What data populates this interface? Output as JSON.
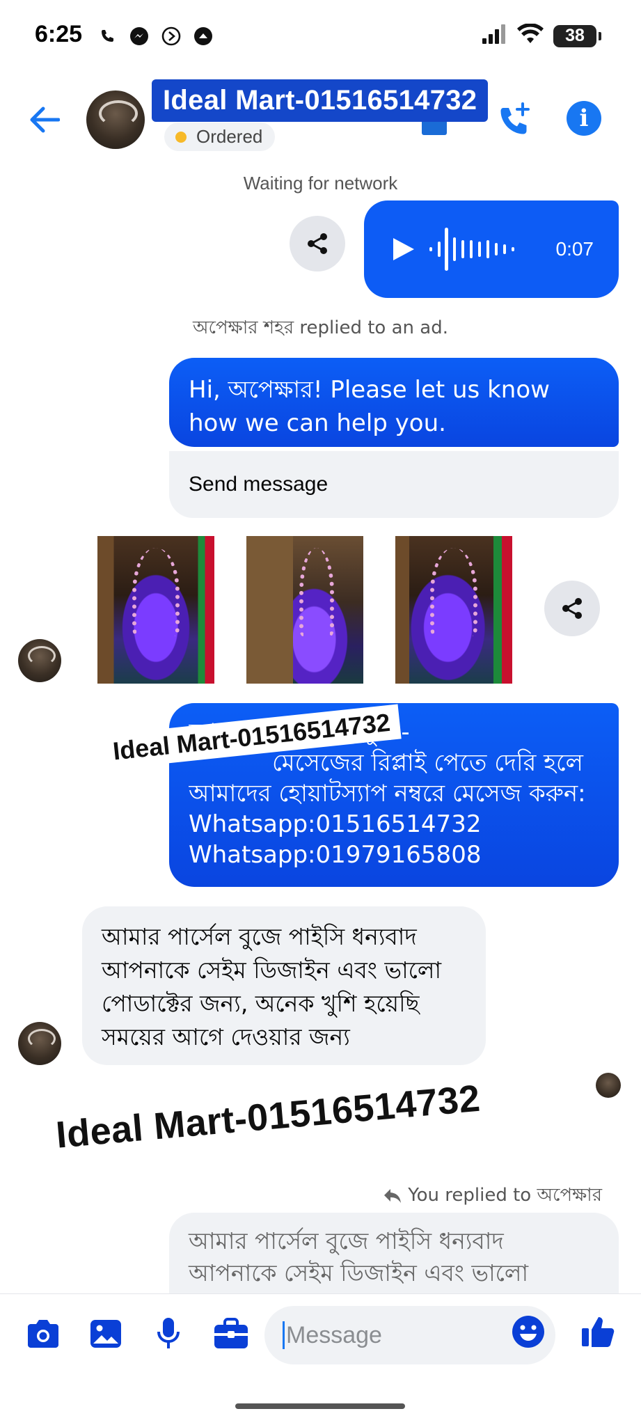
{
  "status_bar": {
    "time": "6:25",
    "battery": "38",
    "left_icons": [
      "phone-icon",
      "messenger-icon",
      "arrow-circle-icon",
      "record-icon"
    ],
    "right_icons": [
      "signal-icon",
      "wifi-icon",
      "battery-icon"
    ]
  },
  "header": {
    "title": "Ideal Mart-01516514732",
    "status_label": "Ordered",
    "status_color": "#f7b928",
    "accent_color": "#0866ff"
  },
  "network_status": "Waiting for network",
  "voice_message": {
    "duration": "0:07"
  },
  "system_message": "অপেক্ষার শহর replied to an ad.",
  "greeting": {
    "text": "Hi, অপেক্ষার! Please let us know how we can help you.",
    "action_label": "Send message"
  },
  "photos": [
    "photo-1",
    "photo-2",
    "photo-3"
  ],
  "bangla_message": {
    "lines": [
      "আসসালামু আলাইকুম -",
      "মেসেজের রিপ্লাই পেতে দেরি হলে",
      "আমাদের হোয়াটস্যাপ নম্বরে মেসেজ করুন:",
      "Whatsapp:01516514732",
      "Whatsapp:01979165808"
    ]
  },
  "watermarks": {
    "small": "Ideal Mart-01516514732",
    "large": "Ideal Mart-01516514732"
  },
  "incoming_message": {
    "lines": [
      "আমার পার্সেল বুজে পাইসি ধন্যবাদ",
      "আপনাকে সেইম ডিজাইন এবং  ভালো",
      "পোডাক্টের জন্য, অনেক খুশি হয়েছি",
      "সময়ের আগে দেওয়ার জন্য"
    ]
  },
  "reply": {
    "label": "You replied to অপেক্ষার",
    "quote_lines": [
      "আমার পার্সেল বুজে পাইসি ধন্যবাদ",
      "আপনাকে সেইম ডিজাইন এবং  ভালো"
    ]
  },
  "composer": {
    "placeholder": "Message",
    "tools": [
      "camera-icon",
      "gallery-icon",
      "microphone-icon",
      "briefcase-icon"
    ]
  }
}
